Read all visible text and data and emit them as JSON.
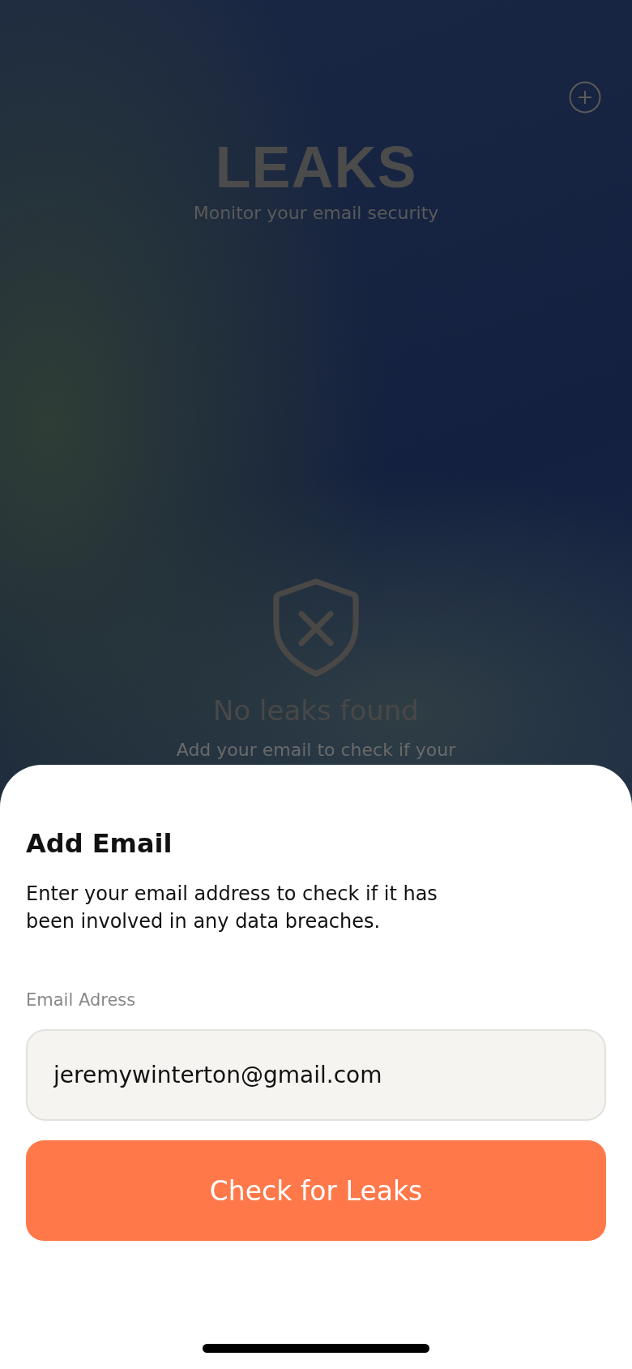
{
  "header": {
    "title": "LEAKS",
    "subtitle": "Monitor your email security"
  },
  "empty_state": {
    "title": "No leaks found",
    "text": "Add your email to check if your"
  },
  "sheet": {
    "title": "Add Email",
    "description": "Enter your email address to check if it has been involved in any data breaches.",
    "field_label": "Email Adress",
    "email_value": "jeremywinterton@gmail.com",
    "button": "Check for Leaks"
  }
}
